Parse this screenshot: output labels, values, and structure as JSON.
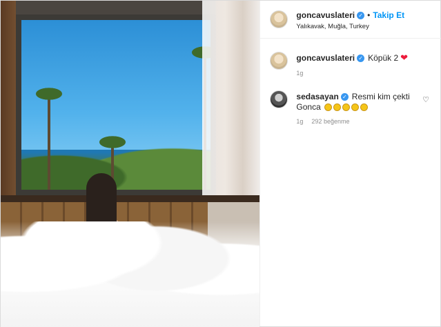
{
  "post": {
    "author": {
      "username": "goncavuslateri",
      "verified_icon": "verified-badge-icon",
      "follow_separator": "•",
      "follow_label": "Takip Et",
      "location": "Yalıkavak, Muğla, Turkey"
    },
    "caption": {
      "username": "goncavuslateri",
      "text": "Köpük 2",
      "emoji": "red-heart-icon",
      "time": "1g"
    },
    "comments": [
      {
        "username": "sedasayan",
        "line1": "Resmi kim çekti",
        "line2": "Gonca",
        "emojis": [
          "face-icon",
          "grinning-icon",
          "grinning-icon",
          "grinning-icon",
          "grinning-icon"
        ],
        "time": "1g",
        "likes": "292 beğenme"
      }
    ]
  },
  "colors": {
    "accent": "#0095f6",
    "verified": "#3897f0",
    "heart": "#ed1c3c",
    "meta": "#8e8e8e"
  }
}
